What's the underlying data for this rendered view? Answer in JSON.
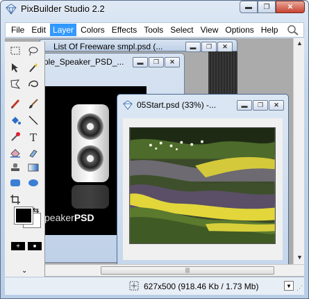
{
  "app": {
    "title": "PixBuilder Studio 2.2"
  },
  "window_controls": {
    "minimize": "▬",
    "maximize": "❐",
    "close": "✕"
  },
  "menu": {
    "items": [
      "File",
      "Edit",
      "Layer",
      "Colors",
      "Effects",
      "Tools",
      "Select",
      "View",
      "Options",
      "Help"
    ],
    "active_index": 2
  },
  "documents": [
    {
      "title": "List Of Freeware smpl.psd (..."
    },
    {
      "title": "ple_Speaker_PSD_..."
    },
    {
      "title": "05Start.psd (33%) -..."
    }
  ],
  "doc_controls": {
    "minimize": "▬",
    "maximize": "❐",
    "close": "✕"
  },
  "speaker_doc": {
    "caption_light": "peaker",
    "caption_bold": "PSD"
  },
  "tools": {
    "swap_symbol": "⇆",
    "add_label": "+",
    "remove_label": "■"
  },
  "status": {
    "text": "627x500  (918.46 Kb / 1.73 Mb)"
  },
  "scroll": {
    "grip": "|||",
    "up": "▲",
    "down": "▼"
  },
  "colors": {
    "accent": "#3399ff",
    "workspace": "#ababab"
  }
}
